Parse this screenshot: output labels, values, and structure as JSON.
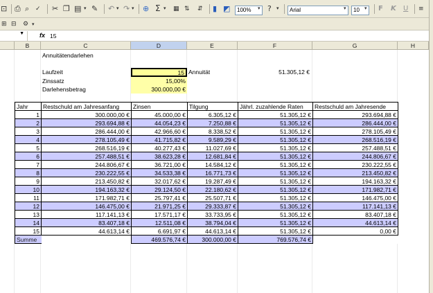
{
  "toolbar": {
    "zoom": "100%",
    "font_name": "Arial",
    "font_size": "10",
    "bold": "F",
    "italic": "K",
    "underline": "U"
  },
  "formula_bar": {
    "fx": "fx",
    "value": "15"
  },
  "columns": [
    "B",
    "C",
    "D",
    "E",
    "F",
    "G",
    "H"
  ],
  "sheet": {
    "title": "Annuitätendarlehen",
    "laufzeit_label": "Laufzeit",
    "laufzeit_value": "15",
    "annuitaet_label": "Annuität",
    "annuitaet_value": "51.305,12 €",
    "zinssatz_label": "Zinssatz",
    "zinssatz_value": "15,00%",
    "darlehen_label": "Darlehensbetrag",
    "darlehen_value": "300.000,00 €"
  },
  "table": {
    "headers": [
      "Jahr",
      "Restschuld am Jahresanfang",
      "Zinsen",
      "Tilgung",
      "Jährl. zuzahlende Raten",
      "Restschuld am Jahresende"
    ],
    "rows": [
      [
        "1",
        "300.000,00 €",
        "45.000,00 €",
        "6.305,12 €",
        "51.305,12 €",
        "293.694,88 €"
      ],
      [
        "2",
        "293.694,88 €",
        "44.054,23 €",
        "7.250,88 €",
        "51.305,12 €",
        "286.444,00 €"
      ],
      [
        "3",
        "286.444,00 €",
        "42.966,60 €",
        "8.338,52 €",
        "51.305,12 €",
        "278.105,49 €"
      ],
      [
        "4",
        "278.105,49 €",
        "41.715,82 €",
        "9.589,29 €",
        "51.305,12 €",
        "268.516,19 €"
      ],
      [
        "5",
        "268.516,19 €",
        "40.277,43 €",
        "11.027,69 €",
        "51.305,12 €",
        "257.488,51 €"
      ],
      [
        "6",
        "257.488,51 €",
        "38.623,28 €",
        "12.681,84 €",
        "51.305,12 €",
        "244.806,67 €"
      ],
      [
        "7",
        "244.806,67 €",
        "36.721,00 €",
        "14.584,12 €",
        "51.305,12 €",
        "230.222,55 €"
      ],
      [
        "8",
        "230.222,55 €",
        "34.533,38 €",
        "16.771,73 €",
        "51.305,12 €",
        "213.450,82 €"
      ],
      [
        "9",
        "213.450,82 €",
        "32.017,62 €",
        "19.287,49 €",
        "51.305,12 €",
        "194.163,32 €"
      ],
      [
        "10",
        "194.163,32 €",
        "29.124,50 €",
        "22.180,62 €",
        "51.305,12 €",
        "171.982,71 €"
      ],
      [
        "11",
        "171.982,71 €",
        "25.797,41 €",
        "25.507,71 €",
        "51.305,12 €",
        "146.475,00 €"
      ],
      [
        "12",
        "146.475,00 €",
        "21.971,25 €",
        "29.333,87 €",
        "51.305,12 €",
        "117.141,13 €"
      ],
      [
        "13",
        "117.141,13 €",
        "17.571,17 €",
        "33.733,95 €",
        "51.305,12 €",
        "83.407,18 €"
      ],
      [
        "14",
        "83.407,18 €",
        "12.511,08 €",
        "38.794,04 €",
        "51.305,12 €",
        "44.613,14 €"
      ],
      [
        "15",
        "44.613,14 €",
        "6.691,97 €",
        "44.613,14 €",
        "51.305,12 €",
        "0,00 €"
      ]
    ],
    "sum_label": "Summe",
    "sum_zinsen": "469.576,74 €",
    "sum_tilgung": "300.000,00 €",
    "sum_raten": "769.576,74 €"
  },
  "icons": [
    "print-icon",
    "preview-icon",
    "spellcheck-icon",
    "cut-icon",
    "copy-icon",
    "paste-icon",
    "format-painter-icon",
    "undo-icon",
    "redo-icon",
    "hyperlink-icon",
    "autosum-icon",
    "sort-asc-icon",
    "sort-desc-icon",
    "chart-wizard-icon",
    "drawing-icon",
    "help-icon"
  ]
}
